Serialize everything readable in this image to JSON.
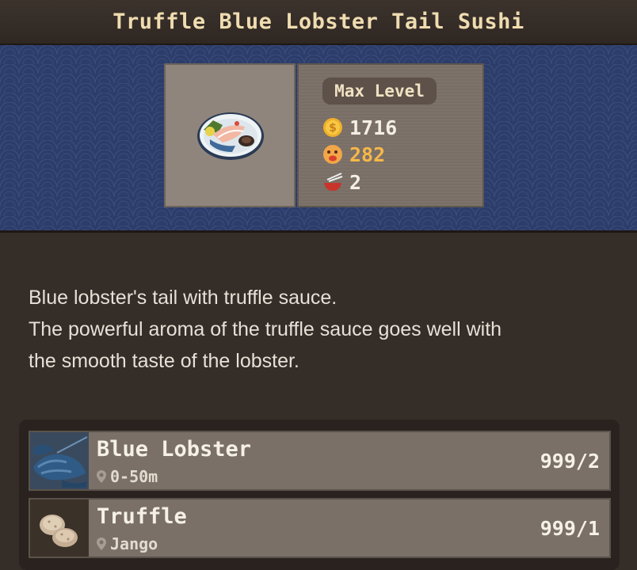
{
  "header": {
    "title": "Truffle Blue Lobster Tail Sushi"
  },
  "dish": {
    "level_badge": "Max Level",
    "stats": [
      {
        "icon": "coin-icon",
        "value": "1716",
        "color": "#f4efe4"
      },
      {
        "icon": "taste-icon",
        "value": "282",
        "color": "#f6b84a"
      },
      {
        "icon": "bowl-icon",
        "value": "2",
        "color": "#f4efe4"
      }
    ]
  },
  "description": {
    "lines": [
      "Blue lobster's tail with truffle sauce.",
      "The powerful aroma of the truffle sauce goes well with",
      "the smooth taste of the lobster."
    ]
  },
  "ingredients": [
    {
      "name": "Blue Lobster",
      "location": "0-50m",
      "count": "999/2",
      "icon": "blue-lobster-icon"
    },
    {
      "name": "Truffle",
      "location": "Jango",
      "count": "999/1",
      "icon": "truffle-icon"
    }
  ],
  "colors": {
    "banner": "#2c3d6b",
    "background": "#352d28",
    "title": "#efdcb0",
    "accent": "#f6b84a"
  }
}
